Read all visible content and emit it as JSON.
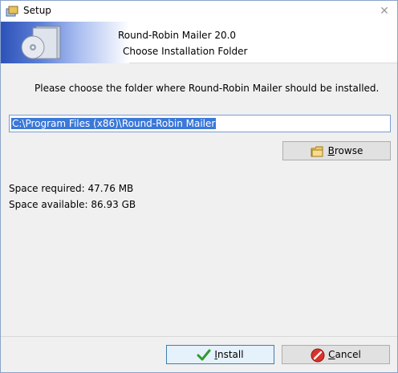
{
  "window": {
    "title": "Setup"
  },
  "banner": {
    "product": "Round-Robin Mailer 20.0",
    "step": "Choose Installation Folder"
  },
  "content": {
    "instruction": "Please choose the folder where Round-Robin Mailer should be installed.",
    "install_path": "C:\\Program Files (x86)\\Round-Robin Mailer",
    "browse_label_prefix": "",
    "browse_label_underlined": "B",
    "browse_label_rest": "rowse",
    "space_required": "Space required: 47.76 MB",
    "space_available": "Space available: 86.93 GB"
  },
  "buttons": {
    "install_underlined": "I",
    "install_rest": "nstall",
    "cancel_underlined": "C",
    "cancel_rest": "ancel"
  },
  "colors": {
    "accent": "#3b78d8",
    "banner_blue": "#2d52b8"
  }
}
